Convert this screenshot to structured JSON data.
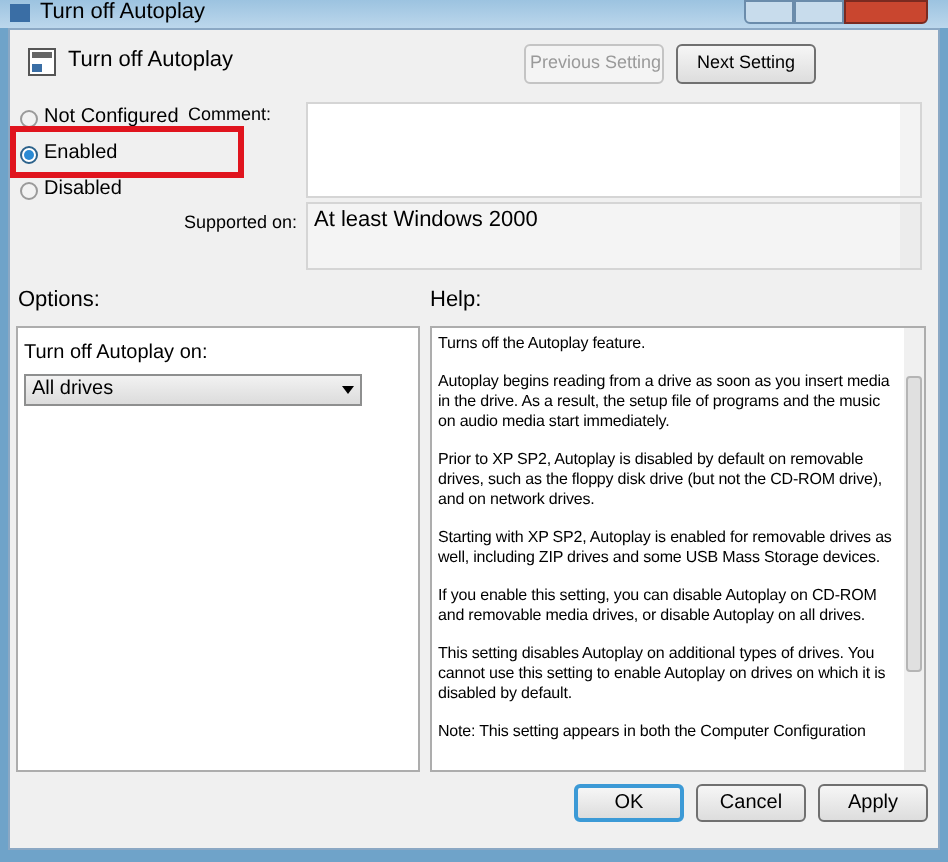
{
  "window": {
    "title": "Turn off Autoplay"
  },
  "header": {
    "title": "Turn off Autoplay"
  },
  "nav_buttons": [
    {
      "label": "Previous Setting",
      "disabled": true
    },
    {
      "label": "Next Setting",
      "disabled": false
    }
  ],
  "state_options": [
    {
      "label": "Not Configured",
      "selected": false
    },
    {
      "label": "Enabled",
      "selected": true
    },
    {
      "label": "Disabled",
      "selected": false
    }
  ],
  "comment": {
    "label": "Comment:"
  },
  "supported_on": {
    "label": "Supported on:",
    "value": "At least Windows 2000"
  },
  "options": {
    "label": "Options:",
    "field_label": "Turn off Autoplay on:",
    "dropdown_value": "All drives"
  },
  "help": {
    "label": "Help:",
    "paragraphs": [
      "Turns off the Autoplay feature.",
      "Autoplay begins reading from a drive as soon as you insert media in the drive. As a result, the setup file of programs and the music on audio media start immediately.",
      "Prior to XP SP2, Autoplay is disabled by default on removable drives, such as the floppy disk drive (but not the CD-ROM drive), and on network drives.",
      "Starting with XP SP2, Autoplay is enabled for removable drives as well, including ZIP drives and some USB Mass Storage devices.",
      "If you enable this setting, you can disable Autoplay on CD-ROM and removable media drives, or disable Autoplay on all drives.",
      "This setting disables Autoplay on additional types of drives. You cannot use this setting to enable Autoplay on drives on which it is disabled by default.",
      "Note: This setting appears in both the Computer Configuration"
    ]
  },
  "buttons": [
    {
      "label": "OK",
      "kind": "default"
    },
    {
      "label": "Cancel",
      "kind": "normal"
    },
    {
      "label": "Apply",
      "kind": "normal"
    }
  ]
}
